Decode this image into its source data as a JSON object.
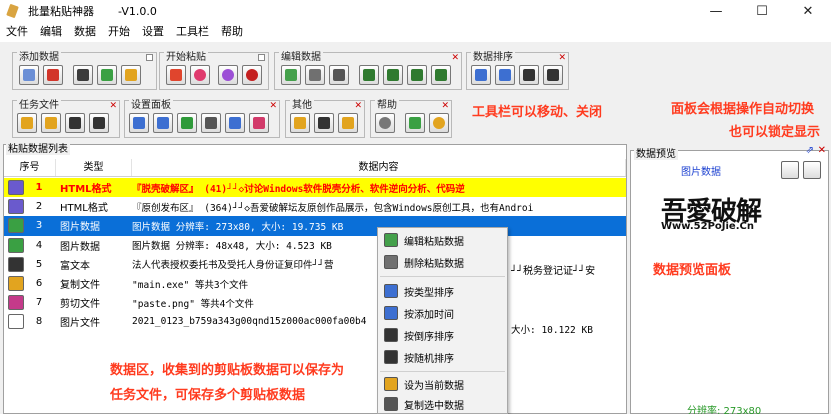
{
  "window": {
    "title": "批量粘贴神器",
    "version": "-V1.0.0",
    "minimize": "—",
    "maximize": "☐",
    "close": "✕"
  },
  "menu": [
    "文件",
    "编辑",
    "数据",
    "开始",
    "设置",
    "工具栏",
    "帮助"
  ],
  "toolbars": {
    "add_data": "添加数据",
    "start_paste": "开始粘贴",
    "edit_data": "编辑数据",
    "sort_data": "数据排序",
    "task_file": "任务文件",
    "settings_panel": "设置面板",
    "other": "其他",
    "help": "帮助"
  },
  "annotations": {
    "toolbar_note": "工具栏可以移动、关闭",
    "panel_note_1": "面板会根据操作自动切换",
    "panel_note_2": "也可以锁定显示",
    "data_note_1": "数据区，收集到的剪贴板数据可以保存为",
    "data_note_2": "任务文件，可保存多个剪贴板数据",
    "preview_note": "数据预览面板"
  },
  "list": {
    "caption": "粘贴数据列表",
    "headers": {
      "no": "序号",
      "type": "类型",
      "content": "数据内容"
    },
    "rows": [
      {
        "no": "1",
        "type": "HTML格式",
        "content": "『脱壳破解区』 (41)┘┘◇讨论Windows软件脱壳分析、软件逆向分析、代码逆"
      },
      {
        "no": "2",
        "type": "HTML格式",
        "content": "『原创发布区』 (364)┘┘◇吾爱破解坛友原创作品展示，包含Windows原创工具，也有Androi"
      },
      {
        "no": "3",
        "type": "图片数据",
        "content": "图片数据 分辨率: 273x80, 大小: 19.735 KB"
      },
      {
        "no": "4",
        "type": "图片数据",
        "content": "图片数据 分辨率: 48x48, 大小: 4.523 KB"
      },
      {
        "no": "5",
        "type": "富文本",
        "content": "法人代表授权委托书及受托人身份证复印件┘┘营"
      },
      {
        "no": "6",
        "type": "复制文件",
        "content": "\"main.exe\" 等共3个文件"
      },
      {
        "no": "7",
        "type": "剪切文件",
        "content": "\"paste.png\" 等共4个文件"
      },
      {
        "no": "8",
        "type": "图片文件",
        "content": "2021_0123_b759a343g00qnd15z000ac000fa00b4"
      }
    ],
    "row5_tail": "┘┘税务登记证┘┘安",
    "row8_tail": "大小: 10.122 KB"
  },
  "context_menu": [
    "编辑粘贴数据",
    "删除粘贴数据",
    "按类型排序",
    "按添加时间",
    "按倒序排序",
    "按随机排序",
    "设为当前数据",
    "复制选中数据"
  ],
  "preview": {
    "caption": "数据预览",
    "type_label": "图片数据",
    "logo_text": "吾愛破解",
    "logo_url": "Www.52PoJie.Cn",
    "footer": "分辨率: 273x80"
  }
}
